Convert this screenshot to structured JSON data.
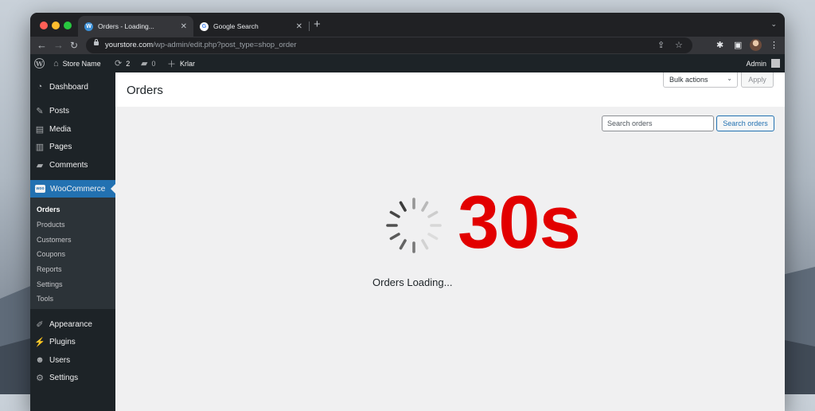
{
  "browser": {
    "tabs": [
      {
        "title": "Orders - Loading...",
        "favicon": "wordpress-icon"
      },
      {
        "title": "Google Search",
        "favicon": "google-icon"
      }
    ],
    "url": {
      "host": "yourstore.com",
      "path": "/wp-admin/edit.php?post_type=shop_order"
    }
  },
  "adminbar": {
    "site_name": "Store Name",
    "updates_count": "2",
    "comments_count": "0",
    "new_label": "Krlar",
    "user_label": "Admin"
  },
  "sidebar": {
    "items": [
      {
        "label": "Dashboard",
        "icon": "dashboard-icon"
      },
      {
        "label": "Posts",
        "icon": "pin-icon"
      },
      {
        "label": "Media",
        "icon": "media-icon"
      },
      {
        "label": "Pages",
        "icon": "pages-icon"
      },
      {
        "label": "Comments",
        "icon": "comment-icon"
      },
      {
        "label": "WooCommerce",
        "icon": "woo-icon"
      }
    ],
    "woo_submenu": [
      "Orders",
      "Products",
      "Customers",
      "Coupons",
      "Reports",
      "Settings",
      "Tools"
    ],
    "bottom_items": [
      {
        "label": "Appearance",
        "icon": "brush-icon"
      },
      {
        "label": "Plugins",
        "icon": "plug-icon"
      },
      {
        "label": "Users",
        "icon": "user-icon"
      },
      {
        "label": "Settings",
        "icon": "settings-icon"
      }
    ]
  },
  "main": {
    "title": "Orders",
    "bulk_actions": "Bulk actions",
    "apply": "Apply",
    "search_placeholder": "Search orders",
    "search_button": "Search orders",
    "loading_time": "30s",
    "loading_text": "Orders Loading..."
  },
  "colors": {
    "accent": "#2271b1",
    "admin_dark": "#1d2327",
    "timer_red": "#e20000"
  }
}
